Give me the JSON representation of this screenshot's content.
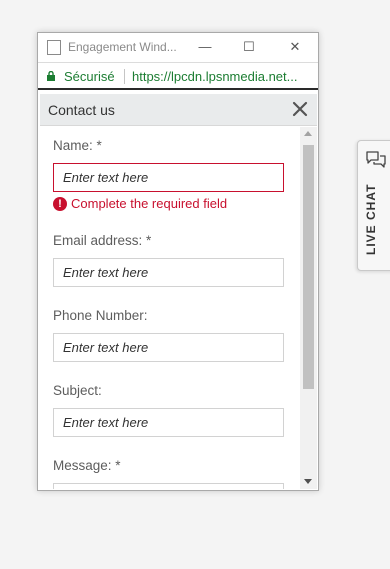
{
  "window": {
    "title": "Engagement Wind...",
    "minimize_glyph": "—",
    "maximize_glyph": "☐",
    "close_glyph": "✕"
  },
  "addressbar": {
    "secure_label": "Sécurisé",
    "url": "https://lpcdn.lpsnmedia.net..."
  },
  "panel": {
    "title": "Contact us",
    "close_icon": "close-icon"
  },
  "form": {
    "name": {
      "label": "Name: *",
      "placeholder": "Enter text here",
      "error": "Complete the required field"
    },
    "email": {
      "label": "Email address: *",
      "placeholder": "Enter text here"
    },
    "phone": {
      "label": "Phone Number:",
      "placeholder": "Enter text here"
    },
    "subject": {
      "label": "Subject:",
      "placeholder": "Enter text here"
    },
    "message": {
      "label": "Message: *"
    },
    "error_icon_glyph": "!"
  },
  "live_chat": {
    "label": "LIVE CHAT",
    "icon": "chat-bubbles-icon"
  },
  "colors": {
    "secure_green": "#1c7d32",
    "error_red": "#c8102e",
    "header_bg": "#e9ebec"
  }
}
